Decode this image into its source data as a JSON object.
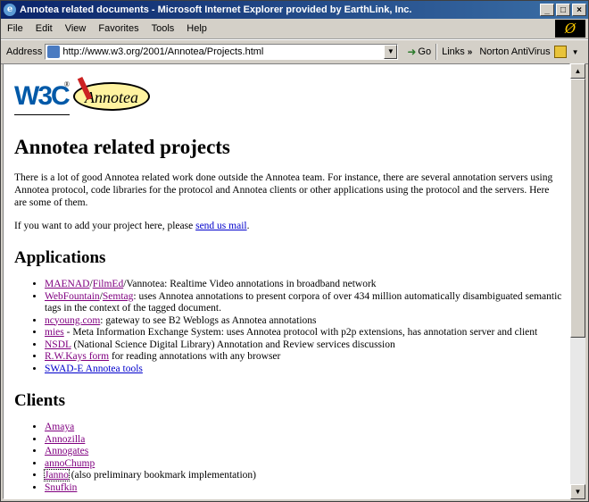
{
  "window": {
    "title": "Annotea related documents - Microsoft Internet Explorer provided by EarthLink, Inc.",
    "minimize": "_",
    "maximize": "□",
    "close": "×"
  },
  "menu": {
    "items": [
      "File",
      "Edit",
      "View",
      "Favorites",
      "Tools",
      "Help"
    ]
  },
  "address": {
    "label": "Address",
    "url": "http://www.w3.org/2001/Annotea/Projects.html",
    "go_label": "Go",
    "links_label": "Links",
    "norton_label": "Norton AntiVirus"
  },
  "page": {
    "w3c_text": "W3C",
    "w3c_reg": "®",
    "annotea_logo": "Annotea",
    "h1": "Annotea related projects",
    "intro": "There is a lot of good Annotea related work done outside the Annotea team. For instance, there are several annotation servers using Annotea protocol, code libraries for the protocol and Annotea clients or other applications using the protocol and the servers. Here are some of them.",
    "addproject_pre": "If you want to add your project here, please ",
    "addproject_link": "send us mail",
    "addproject_post": ".",
    "applications_heading": "Applications",
    "applications": [
      {
        "a1": "MAENAD",
        "sep": "/",
        "a2": "FilmEd",
        "rest": "/Vannotea: Realtime Video annotations in broadband network"
      },
      {
        "a1": "WebFountain",
        "sep": "/",
        "a2": "Semtag",
        "rest": ": uses Annotea annotations to present corpora of over 434 million automatically disambiguated semantic tags in the context of the tagged document."
      },
      {
        "a1": "ncyoung.com",
        "rest": ": gateway to see B2 Weblogs as Annotea annotations"
      },
      {
        "a1": "mies",
        "rest": " - Meta Information Exchange System: uses Annotea protocol with p2p extensions, has annotation server and client"
      },
      {
        "a1": "NSDL",
        "rest": " (National Science Digital Library) Annotation and Review services discussion"
      },
      {
        "a1": "R.W.Kays form",
        "rest": " for reading annotations with any browser"
      },
      {
        "a1": "SWAD-E Annotea tools",
        "rest": ""
      }
    ],
    "clients_heading": "Clients",
    "clients": [
      {
        "a1": "Amaya",
        "rest": ""
      },
      {
        "a1": "Annozilla",
        "rest": ""
      },
      {
        "a1": "Annogates",
        "rest": ""
      },
      {
        "a1": "annoChump",
        "rest": ""
      },
      {
        "a1": "Janno",
        "rest": " (also preliminary bookmark implementation)"
      },
      {
        "a1": "Snufkin",
        "rest": ""
      }
    ]
  },
  "colors": {
    "link": "#0000cc",
    "visited": "#800080",
    "titlebar_start": "#0a246a",
    "titlebar_end": "#3a6ea5"
  }
}
